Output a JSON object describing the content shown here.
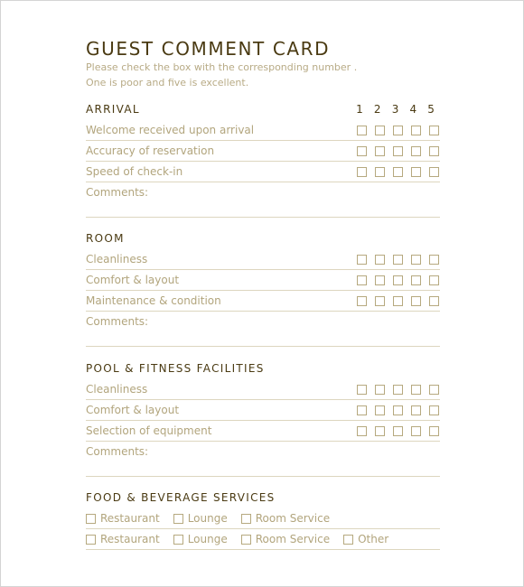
{
  "card": {
    "title": "GUEST COMMENT CARD",
    "instructions": [
      "Please check the box with the corresponding number .",
      "One is poor and five is excellent."
    ],
    "scale_labels": [
      "1",
      "2",
      "3",
      "4",
      "5"
    ],
    "comments_label": "Comments:"
  },
  "sections": [
    {
      "title": "ARRIVAL",
      "items": [
        "Welcome received upon arrival",
        "Accuracy of reservation",
        "Speed of check-in"
      ]
    },
    {
      "title": "ROOM",
      "items": [
        "Cleanliness",
        "Comfort & layout",
        "Maintenance & condition"
      ]
    },
    {
      "title": "POOL & FITNESS FACILITIES",
      "items": [
        "Cleanliness",
        "Comfort & layout",
        "Selection of equipment"
      ]
    }
  ],
  "food_beverage": {
    "title": "FOOD & BEVERAGE SERVICES",
    "rows": [
      [
        "Restaurant",
        "Lounge",
        "Room Service"
      ],
      [
        "Restaurant",
        "Lounge",
        "Room Service",
        "Other"
      ]
    ]
  },
  "colors": {
    "heading": "#4a3a12",
    "body_text": "#b2a57d",
    "rule": "#ddd6bf"
  }
}
